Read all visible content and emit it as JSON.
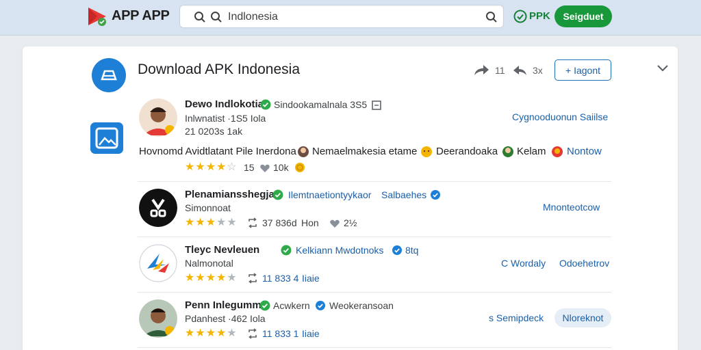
{
  "header": {
    "logo_text": "APP APP",
    "search": {
      "value": "Indlonesia"
    },
    "apk_label": "PPK",
    "signin_label": "Seigduet"
  },
  "colors": {
    "brand_green": "#18983a",
    "link_blue": "#1a5fa8",
    "star": "#f4b400"
  },
  "card": {
    "title": "Download APK Indonesia",
    "share_count": "11",
    "reply_count": "3x",
    "follow_label": "+ Iagont",
    "items": [
      {
        "name": "Dewo Indlokotia",
        "tagline": "Sindookamalnala 3S5",
        "sub": "Inlwnatist ·1S5 Iola",
        "meta": "21 0203s 1ak",
        "right_link": "Cygnooduonun Saiilse",
        "description": "Hovnomd Avidtlatant Pile Inerdona",
        "tags": [
          "Nemaelmakesia etame",
          "Deerandoaka",
          "Kelam",
          "Nontow"
        ],
        "rating": 3.5,
        "rating_count": "15",
        "secondary_count": "10k"
      },
      {
        "name": "Plenamiansshegja",
        "tagline": "Ilemtnaetiontyykaor",
        "tagline2": "Salbaehes",
        "sub": "Simonnoat",
        "rating": 3.5,
        "repost_count": "37 836d",
        "repost_suffix": "Hon",
        "likes": "2½",
        "right_link": "Mnonteotcow"
      },
      {
        "name": "Tleyc Nevleuen",
        "tagline": "Kelkiann Mwdotnoks",
        "tagline_suffix": "8tq",
        "sub": "Nalmonotal",
        "rating": 4.5,
        "repost_count": "11 833 4",
        "repost_suffix": "Iiaie",
        "right_link": "C Wordaly",
        "right_link2": "Odoehetrov"
      },
      {
        "name": "Penn Inlegumm",
        "tagline": "Acwkern",
        "tagline2": "Weokeransoan",
        "sub": "Pdanhest ·462 Iola",
        "rating": 4.5,
        "repost_count": "11 833 1",
        "repost_suffix": "Iiaie",
        "right_link": "s Semipdeck",
        "pill_label": "Nloreknot"
      }
    ]
  },
  "icons": [
    "app-logo-icon",
    "search-icon",
    "apk-check-icon",
    "share-icon",
    "reply-icon",
    "chevron-down-icon",
    "verified-icon",
    "repost-icon",
    "heart-icon",
    "star-icon"
  ]
}
